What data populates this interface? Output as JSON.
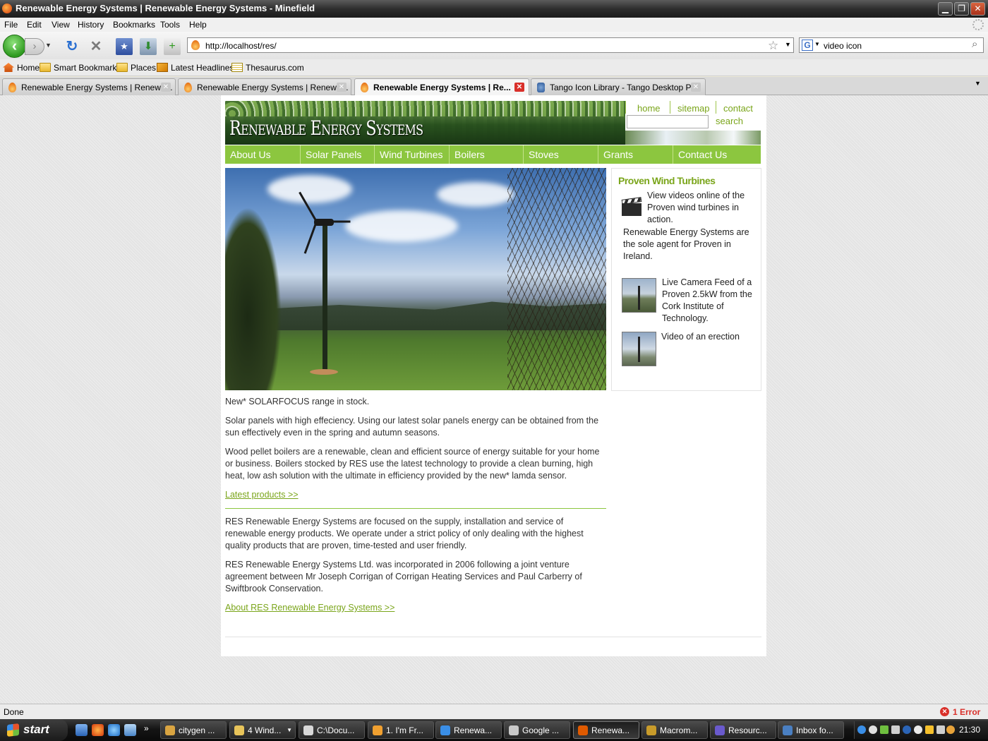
{
  "window": {
    "title": "Renewable Energy Systems | Renewable Energy Systems - Minefield",
    "controls": {
      "minimize": "▁",
      "maximize": "❐",
      "close": "✕"
    }
  },
  "menu": [
    "File",
    "Edit",
    "View",
    "History",
    "Bookmarks",
    "Tools",
    "Help"
  ],
  "navbar": {
    "back_icon": "arrow-left-icon",
    "forward_icon": "arrow-right-icon",
    "url": "http://localhost/res/",
    "search_value": "video icon",
    "search_engine": "G"
  },
  "bookmarks": [
    "Home",
    "Smart Bookmarks",
    "Places",
    "Latest Headlines",
    "Thesaurus.com"
  ],
  "tabs": [
    {
      "label": "Renewable Energy Systems | Renewa...",
      "active": false
    },
    {
      "label": "Renewable Energy Systems | Renewa...",
      "active": false
    },
    {
      "label": "Renewable Energy Systems | Re...",
      "active": true
    },
    {
      "label": "Tango Icon Library - Tango Desktop Pr...",
      "active": false
    }
  ],
  "site": {
    "logo": "Renewable Energy Systems",
    "header_links": {
      "home": "home",
      "sitemap": "sitemap",
      "contact": "contact",
      "search": "search"
    },
    "nav": [
      "About Us",
      "Solar Panels",
      "Wind Turbines",
      "Boilers",
      "Stoves",
      "Grants",
      "Contact Us"
    ],
    "main": {
      "p1": "New* SOLARFOCUS range in stock.",
      "p2": "Solar panels with high effeciency. Using our latest solar panels energy can be obtained from the sun effectively even in the spring and autumn seasons.",
      "p3": "Wood pellet boilers are a renewable, clean and efficient source of energy suitable for your home or business. Boilers stocked by RES use the latest technology to provide a clean burning, high heat, low ash solution with the ultimate in efficiency provided by the new* lamda sensor.",
      "latest_link": "Latest products >>",
      "p4": "RES Renewable Energy Systems are focused on the supply, installation and service of renewable energy products. We operate under a strict policy of only dealing with the highest quality products that are proven, time-tested and user friendly.",
      "p5": "RES Renewable Energy Systems Ltd. was incorporated in 2006 following a joint venture agreement between Mr Joseph Corrigan of Corrigan Heating Services and Paul Carberry of Swiftbrook Conservation.",
      "about_link": "About RES Renewable Energy Systems >>"
    },
    "sidebar": {
      "title": "Proven Wind Turbines",
      "videos_text": "View videos online of the Proven wind turbines in action.",
      "agent_text": "Renewable Energy Systems are the sole agent for Proven in Ireland.",
      "camera_text": "Live Camera Feed of a Proven 2.5kW from the Cork Institute of Technology.",
      "erection_text": "Video of an erection"
    }
  },
  "status": {
    "text": "Done",
    "error": "1 Error"
  },
  "taskbar": {
    "start": "start",
    "tasks": [
      {
        "label": "citygen ...",
        "color": "#d9a441"
      },
      {
        "label": "4 Wind...",
        "color": "#e8c45a"
      },
      {
        "label": "C:\\Docu...",
        "color": "#d8d8d8"
      },
      {
        "label": "1. I'm Fr...",
        "color": "#f0a030"
      },
      {
        "label": "Renewa...",
        "color": "#3a8ee6"
      },
      {
        "label": "Google ...",
        "color": "#c8c8c8"
      },
      {
        "label": "Renewa...",
        "color": "#e05a00"
      },
      {
        "label": "Macrom...",
        "color": "#c89b2a"
      },
      {
        "label": "Resourc...",
        "color": "#6a5acd"
      },
      {
        "label": "Inbox fo...",
        "color": "#4a7fc1"
      }
    ],
    "clock": "21:30"
  }
}
